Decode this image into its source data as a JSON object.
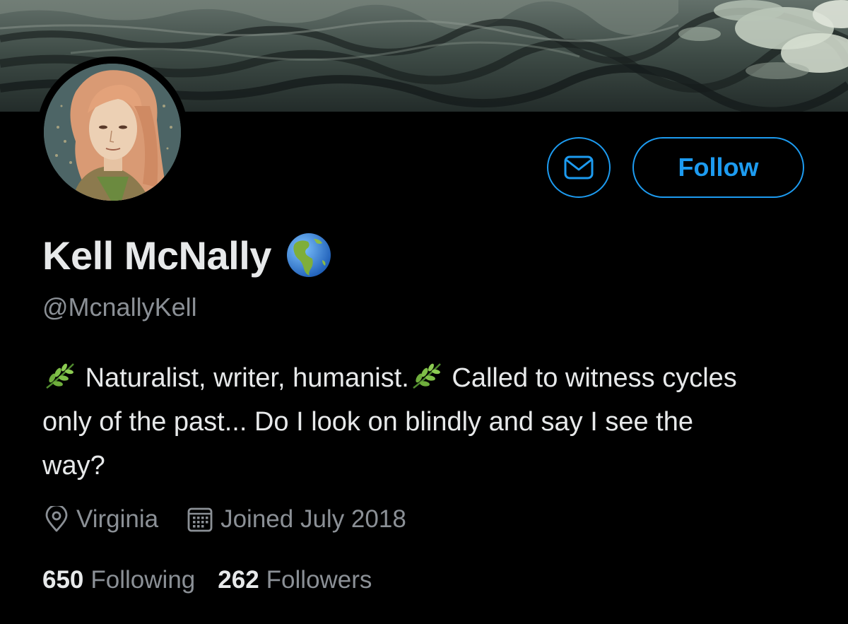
{
  "profile": {
    "name": "Kell McNally",
    "name_emoji": "globe-americas",
    "handle": "@McnallyKell",
    "bio": {
      "part1": "Naturalist, writer, humanist.",
      "part2": "Called to witness cycles only of the past... Do I look on blindly and say I see the way?"
    },
    "location": "Virginia",
    "joined": "Joined July 2018",
    "following_count": "650",
    "following_label": "Following",
    "followers_count": "262",
    "followers_label": "Followers"
  },
  "actions": {
    "follow_label": "Follow",
    "message_icon": "envelope-icon"
  },
  "icons": {
    "location": "location-pin-icon",
    "calendar": "calendar-icon",
    "bio_emoji": "herb-icon"
  },
  "colors": {
    "background": "#000000",
    "accent": "#1d9bf0",
    "primary_text": "#e7e9ea",
    "secondary_text": "#8b9096"
  }
}
